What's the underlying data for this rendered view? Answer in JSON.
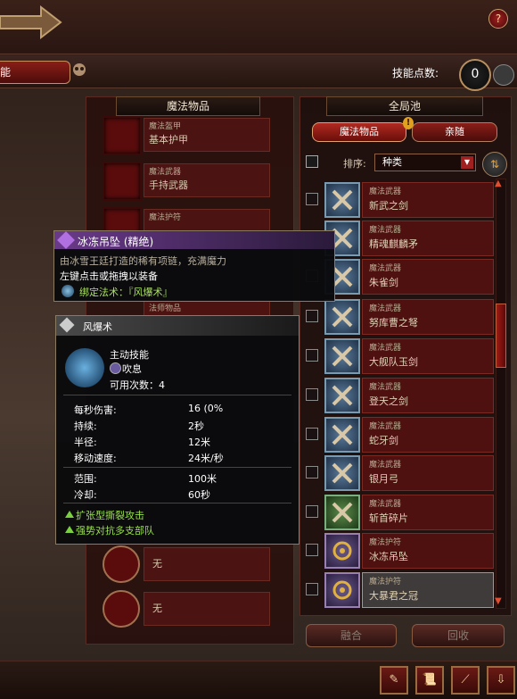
{
  "header": {
    "skills_tab": "能",
    "skill_points_label": "技能点数:",
    "skill_points_value": "0",
    "help_icon": "?"
  },
  "left_panel": {
    "title": "魔法物品",
    "slots": [
      {
        "category": "魔法盔甲",
        "name": "基本护甲"
      },
      {
        "category": "魔法武器",
        "name": "手持武器"
      },
      {
        "category": "魔法护符",
        "name": ""
      },
      {
        "category": "法师物品",
        "name": ""
      }
    ],
    "round_slots": [
      {
        "name": "无"
      },
      {
        "name": "无"
      }
    ]
  },
  "right_panel": {
    "title": "全局池",
    "tabs": [
      "魔法物品",
      "亲随"
    ],
    "sort_label": "排序:",
    "sort_value": "种类",
    "items": [
      {
        "category": "魔法武器",
        "name": "新武之剑"
      },
      {
        "category": "魔法武器",
        "name": "精魂麒麟矛"
      },
      {
        "category": "魔法武器",
        "name": "朱雀剑"
      },
      {
        "category": "魔法武器",
        "name": "努库曹之弩"
      },
      {
        "category": "魔法武器",
        "name": "大舰队玉剑"
      },
      {
        "category": "魔法武器",
        "name": "登天之剑"
      },
      {
        "category": "魔法武器",
        "name": "蛇牙剑"
      },
      {
        "category": "魔法武器",
        "name": "银月弓"
      },
      {
        "category": "魔法武器",
        "name": "斩首碎片"
      },
      {
        "category": "魔法护符",
        "name": "冰冻吊坠"
      },
      {
        "category": "魔法护符",
        "name": "大暴君之冠"
      }
    ],
    "fuse_label": "融合",
    "recycle_label": "回收"
  },
  "tooltip_item": {
    "title": "冰冻吊坠 (精绝)",
    "description": "由冰雪王廷打造的稀有项链，充满魔力",
    "action": "左键点击或拖拽以装备",
    "bound_spell": "绑定法术：『风爆术』"
  },
  "tooltip_spell": {
    "title": "风爆术",
    "type": "主动技能",
    "subtype": "吹息",
    "uses": "可用次数：4",
    "stats": [
      {
        "k": "每秒伤害:",
        "v": "16 (0%"
      },
      {
        "k": "持续:",
        "v": "2秒"
      },
      {
        "k": "半径:",
        "v": "12米"
      },
      {
        "k": "移动速度:",
        "v": "24米/秒"
      }
    ],
    "stats2": [
      {
        "k": "范围:",
        "v": "100米"
      },
      {
        "k": "冷却:",
        "v": "60秒"
      }
    ],
    "perks": [
      "扩张型撕裂攻击",
      "强势对抗多支部队"
    ]
  },
  "toolbar": {
    "buttons": [
      "✎",
      "📜",
      "⟋",
      "⇩"
    ]
  }
}
